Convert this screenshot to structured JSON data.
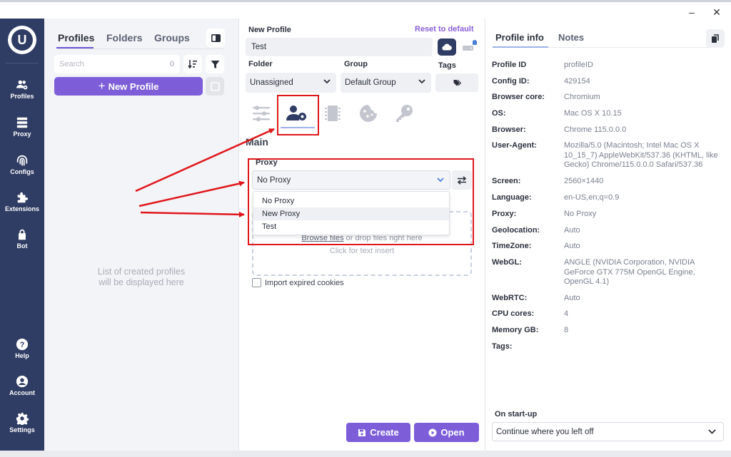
{
  "window": {
    "minimize_glyph": "–",
    "close_glyph": "✕"
  },
  "sidebar": {
    "logo": "U",
    "items": [
      {
        "label": "Profiles",
        "icon": "users-gear-icon"
      },
      {
        "label": "Proxy",
        "icon": "server-icon"
      },
      {
        "label": "Configs",
        "icon": "fingerprint-icon"
      },
      {
        "label": "Extensions",
        "icon": "puzzle-icon"
      },
      {
        "label": "Bot",
        "icon": "lock-icon"
      },
      {
        "label": "Help",
        "icon": "help-icon"
      },
      {
        "label": "Account",
        "icon": "account-icon"
      },
      {
        "label": "Settings",
        "icon": "gear-icon"
      }
    ]
  },
  "profiles_panel": {
    "tabs": [
      "Profiles",
      "Folders",
      "Groups"
    ],
    "search_placeholder": "Search",
    "search_count": "0",
    "new_profile_label": "New Profile",
    "empty_line1": "List of created profiles",
    "empty_line2": "will be displayed here"
  },
  "editor": {
    "title_label": "New Profile",
    "reset_label": "Reset to default",
    "name_value": "Test",
    "folder_label": "Folder",
    "folder_value": "Unassigned",
    "group_label": "Group",
    "group_value": "Default Group",
    "tags_label": "Tags",
    "section_title": "Main",
    "proxy_label": "Proxy",
    "proxy_value": "No Proxy",
    "proxy_options": [
      "No Proxy",
      "New Proxy",
      "Test"
    ],
    "dropzone_browse": "Browse files",
    "dropzone_rest": " or drop files right here",
    "dropzone_click": "Click for text insert",
    "import_expired_label": "Import expired cookies",
    "create_label": "Create",
    "open_label": "Open"
  },
  "info": {
    "tabs": [
      "Profile info",
      "Notes"
    ],
    "rows": [
      {
        "key": "Profile ID",
        "value": "profileID"
      },
      {
        "key": "Config ID:",
        "value": "429154"
      },
      {
        "key": "Browser core:",
        "value": "Chromium"
      },
      {
        "key": "OS:",
        "value": "Mac OS X 10.15"
      },
      {
        "key": "Browser:",
        "value": "Chrome 115.0.0.0"
      },
      {
        "key": "User-Agent:",
        "value": "Mozilla/5.0 (Macintosh; Intel Mac OS X 10_15_7) AppleWebKit/537.36 (KHTML, like Gecko) Chrome/115.0.0.0 Safari/537.36"
      },
      {
        "key": "Screen:",
        "value": "2560×1440"
      },
      {
        "key": "Language:",
        "value": "en-US,en;q=0.9"
      },
      {
        "key": "Proxy:",
        "value": "No Proxy"
      },
      {
        "key": "Geolocation:",
        "value": "Auto"
      },
      {
        "key": "TimeZone:",
        "value": "Auto"
      },
      {
        "key": "WebGL:",
        "value": "ANGLE (NVIDIA Corporation, NVIDIA GeForce GTX 775M OpenGL Engine, OpenGL 4.1)"
      },
      {
        "key": "WebRTC:",
        "value": "Auto"
      },
      {
        "key": "CPU cores:",
        "value": "4"
      },
      {
        "key": "Memory GB:",
        "value": "8"
      },
      {
        "key": "Tags:",
        "value": ""
      }
    ],
    "startup_label": "On start-up",
    "startup_value": "Continue where you left off"
  },
  "colors": {
    "sidebar": "#2f3c63",
    "accent": "#7d5ed8",
    "highlight": "#e0161b"
  }
}
